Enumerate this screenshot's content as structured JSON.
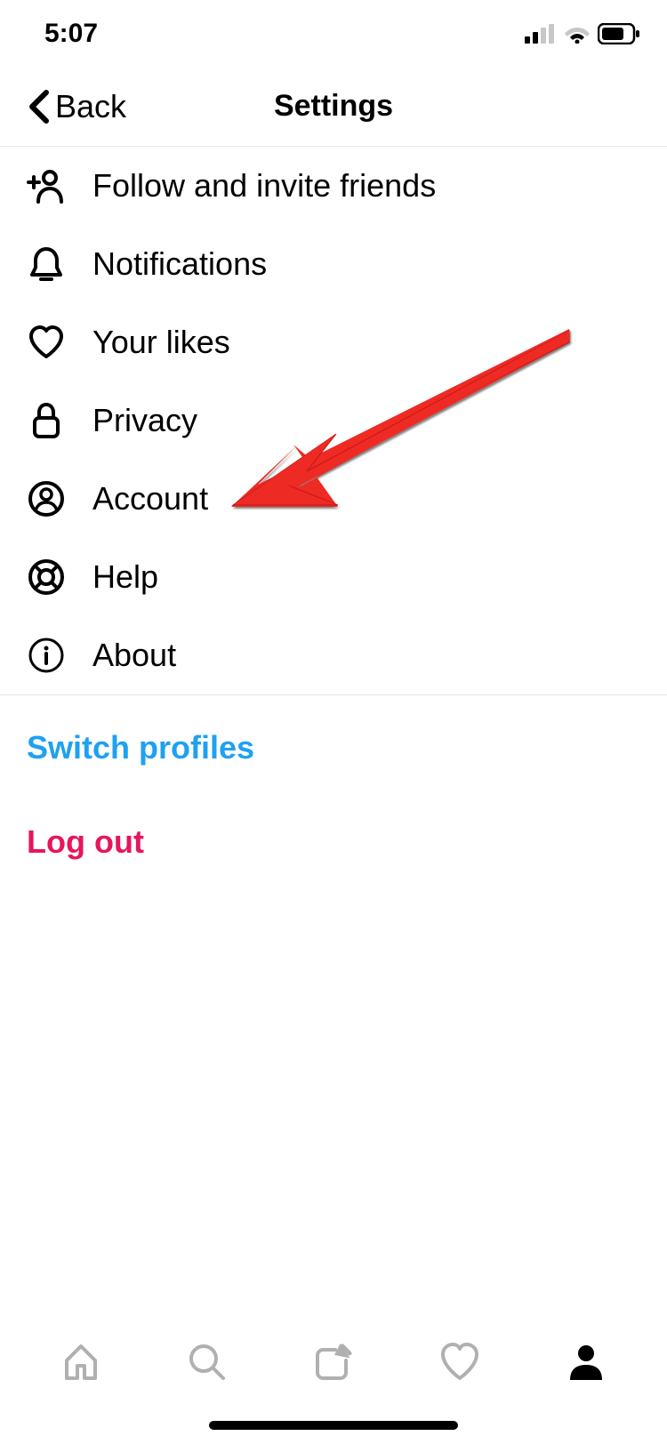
{
  "status_bar": {
    "time": "5:07"
  },
  "header": {
    "back_label": "Back",
    "title": "Settings"
  },
  "settings_items": [
    {
      "key": "follow",
      "label": "Follow and invite friends"
    },
    {
      "key": "notifications",
      "label": "Notifications"
    },
    {
      "key": "likes",
      "label": "Your likes"
    },
    {
      "key": "privacy",
      "label": "Privacy"
    },
    {
      "key": "account",
      "label": "Account"
    },
    {
      "key": "help",
      "label": "Help"
    },
    {
      "key": "about",
      "label": "About"
    }
  ],
  "actions": {
    "switch_profiles": "Switch profiles",
    "log_out": "Log out"
  }
}
